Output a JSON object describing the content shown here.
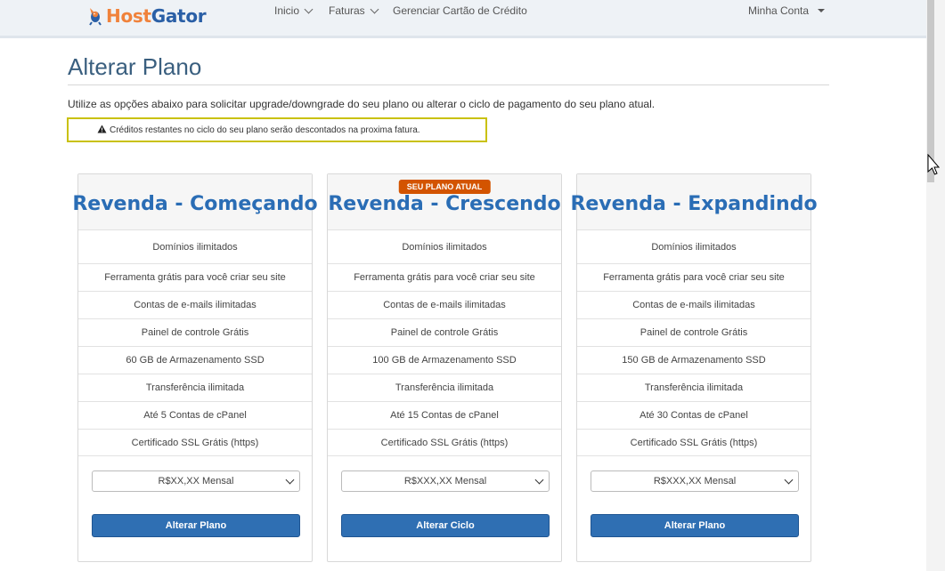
{
  "navbar": {
    "logo_part1": "Host",
    "logo_part2": "Gator",
    "items": [
      {
        "label": "Inicio"
      },
      {
        "label": "Faturas"
      },
      {
        "label": "Gerenciar Cartão de Crédito"
      }
    ],
    "account_label": "Minha Conta"
  },
  "page": {
    "title": "Alterar Plano",
    "intro": "Utilize as opções abaixo para solicitar upgrade/downgrade do seu plano ou alterar o ciclo de pagamento do seu plano atual.",
    "alert": "Créditos restantes no ciclo do seu plano serão descontados na proxima fatura."
  },
  "plans": [
    {
      "title": "Revenda - Começando",
      "badge": "",
      "features": [
        "Domínios ilimitados",
        "Ferramenta grátis para você criar seu site",
        "Contas de e-mails ilimitadas",
        "Painel de controle Grátis",
        "60 GB de Armazenamento SSD",
        "Transferência ilimitada",
        "Até 5 Contas de cPanel",
        "Certificado SSL Grátis (https)"
      ],
      "price": "R$XX,XX Mensal",
      "button": "Alterar Plano"
    },
    {
      "title": "Revenda - Crescendo",
      "badge": "SEU PLANO ATUAL",
      "features": [
        "Domínios ilimitados",
        "Ferramenta grátis para você criar seu site",
        "Contas de e-mails ilimitadas",
        "Painel de controle Grátis",
        "100 GB de Armazenamento SSD",
        "Transferência ilimitada",
        "Até 15 Contas de cPanel",
        "Certificado SSL Grátis (https)"
      ],
      "price": "R$XXX,XX Mensal",
      "button": "Alterar Ciclo"
    },
    {
      "title": "Revenda - Expandindo",
      "badge": "",
      "features": [
        "Domínios ilimitados",
        "Ferramenta grátis para você criar seu site",
        "Contas de e-mails ilimitadas",
        "Painel de controle Grátis",
        "150 GB de Armazenamento SSD",
        "Transferência ilimitada",
        "Até 30 Contas de cPanel",
        "Certificado SSL Grátis (https)"
      ],
      "price": "R$XXX,XX  Mensal",
      "button": "Alterar Plano"
    }
  ],
  "colors": {
    "accent": "#2f6fb3",
    "title_blue": "#2a6db5",
    "badge": "#d35400",
    "alert_border": "#c9c10a",
    "logo_orange": "#f0823b"
  },
  "icons": {
    "logo": "gator-mascot-icon",
    "alert": "warning-icon",
    "dropdown": "chevron-down-icon",
    "cursor": "mouse-pointer-icon"
  }
}
